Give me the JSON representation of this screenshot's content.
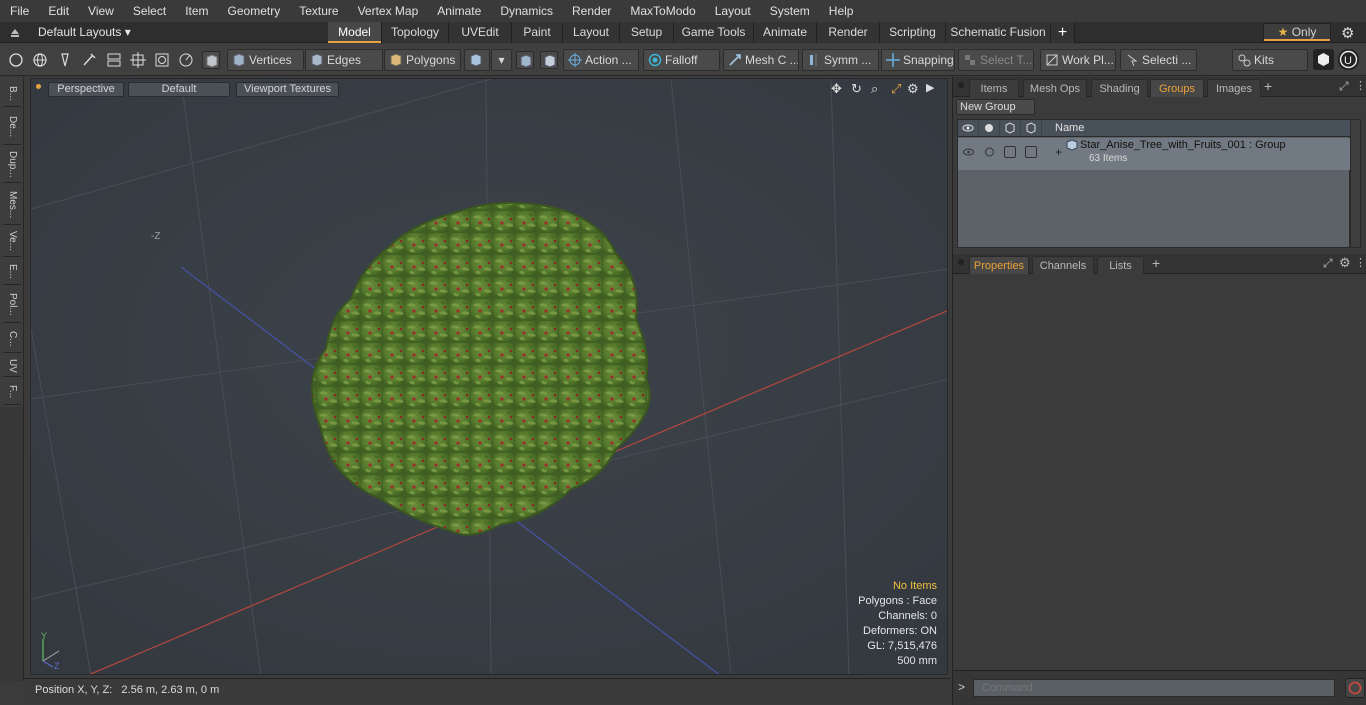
{
  "menu": [
    "File",
    "Edit",
    "View",
    "Select",
    "Item",
    "Geometry",
    "Texture",
    "Vertex Map",
    "Animate",
    "Dynamics",
    "Render",
    "MaxToModo",
    "Layout",
    "System",
    "Help"
  ],
  "layout_dropdown": "Default Layouts",
  "layout_tabs": [
    "Model",
    "Topology",
    "UVEdit",
    "Paint",
    "Layout",
    "Setup",
    "Game Tools",
    "Animate",
    "Render",
    "Scripting",
    "Schematic Fusion"
  ],
  "active_layout_tab": "Model",
  "only_label": "Only",
  "toolbar": {
    "vertices": "Vertices",
    "edges": "Edges",
    "polygons": "Polygons",
    "action": "Action ...",
    "falloff": "Falloff",
    "mesh": "Mesh C ...",
    "symm": "Symm ...",
    "snapping": "Snapping",
    "select": "Select T...",
    "workplane": "Work Pl...",
    "selection": "Selecti ...",
    "kits": "Kits"
  },
  "left_tabs": [
    "B...",
    "De...",
    "Dup...",
    "Mes...",
    "Ve...",
    "E...",
    "Pol...",
    "C...",
    "UV",
    "F..."
  ],
  "viewport": {
    "perspective": "Perspective",
    "default": "Default",
    "textures": "Viewport Textures",
    "axis_label": "-Z",
    "stats": {
      "no_items": "No Items",
      "polygons": "Polygons : Face",
      "channels": "Channels: 0",
      "deformers": "Deformers: ON",
      "gl": "GL: 7,515,476",
      "scale": "500 mm"
    }
  },
  "status": "Position X, Y, Z:   2.56 m, 2.63 m, 0 m",
  "panel": {
    "tabs": [
      "Items",
      "Mesh Ops",
      "Shading",
      "Groups",
      "Images"
    ],
    "active_tab": "Groups",
    "new_group": "New Group",
    "col_name": "Name",
    "group_name": "Star_Anise_Tree_with_Fruits_001 : Group",
    "group_count": "63 Items",
    "lower_tabs": [
      "Properties",
      "Channels",
      "Lists"
    ],
    "lower_active": "Properties",
    "command_placeholder": "Command"
  },
  "colors": {
    "accent": "#e7a343",
    "x_axis": "#c0463c",
    "z_axis": "#4350a8"
  }
}
